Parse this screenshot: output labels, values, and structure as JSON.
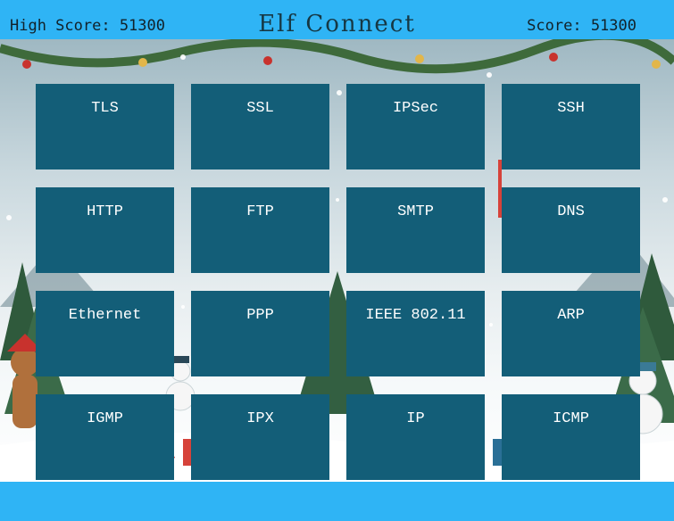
{
  "header": {
    "high_score_label": "High Score: 51300",
    "title": "Elf Connect",
    "score_label": "Score: 51300"
  },
  "tiles": [
    "TLS",
    "SSL",
    "IPSec",
    "SSH",
    "HTTP",
    "FTP",
    "SMTP",
    "DNS",
    "Ethernet",
    "PPP",
    "IEEE 802.11",
    "ARP",
    "IGMP",
    "IPX",
    "IP",
    "ICMP"
  ],
  "colors": {
    "header_bar": "#2fb4f5",
    "tile": "#135e78",
    "tile_text": "#ffffff"
  }
}
